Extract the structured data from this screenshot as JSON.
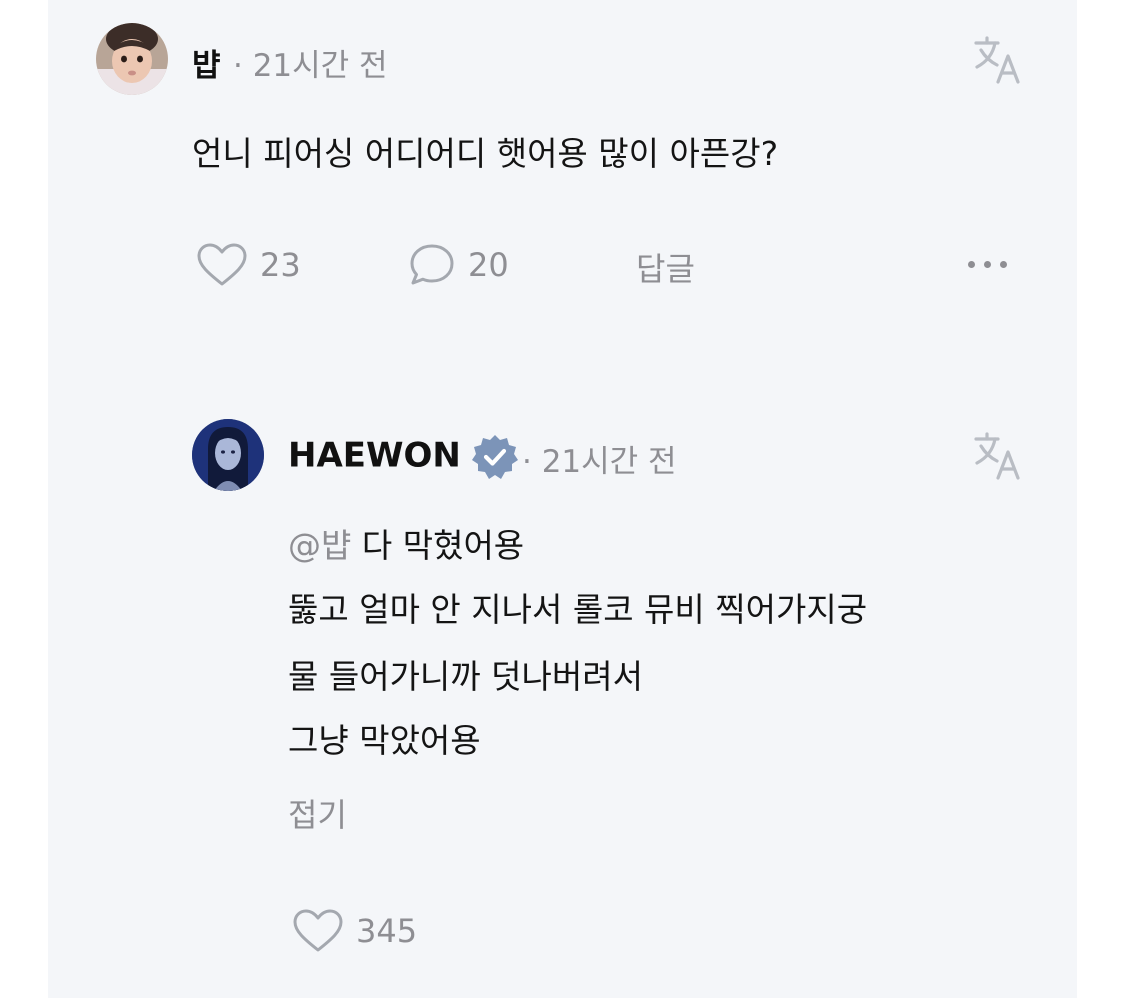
{
  "comment": {
    "author": "뱝",
    "time": "· 21시간 전",
    "text": "언니 피어싱 어디어디 햇어용 많이 아픈강?",
    "likes": "23",
    "replies": "20",
    "reply_label": "답글",
    "avatar_icon": "baby-photo-avatar",
    "translate_icon": "translate-icon",
    "more_icon": "more-icon"
  },
  "reply": {
    "author": "HAEWON",
    "verified_icon": "verified-badge-icon",
    "time": "· 21시간 전",
    "mention": "@뱝",
    "line1": "다 막혔어용",
    "line2": "뚫고 얼마 안 지나서 롤코 뮤비 찍어가지궁",
    "line3": "물 들어가니까 덧나버려서",
    "line4": "그냥 막았어용",
    "collapse_label": "접기",
    "likes": "345",
    "avatar_icon": "haewon-photo-avatar",
    "translate_icon": "translate-icon"
  },
  "colors": {
    "panel_bg": "#f4f6f9",
    "muted": "#8e8e93",
    "text": "#141414",
    "verified": "#7c94b8"
  }
}
